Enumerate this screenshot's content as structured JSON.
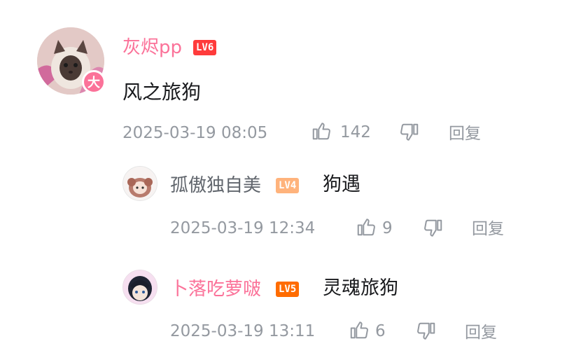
{
  "comment": {
    "username": "灰烬pp",
    "level": "LV6",
    "avatar_badge": "大",
    "text": "风之旅狗",
    "timestamp": "2025-03-19 08:05",
    "likes": "142",
    "reply_label": "回复"
  },
  "replies": [
    {
      "username": "孤傲独自美",
      "level": "LV4",
      "text": "狗遇",
      "timestamp": "2025-03-19 12:34",
      "likes": "9",
      "reply_label": "回复"
    },
    {
      "username": "卜落吃萝啵",
      "level": "LV5",
      "text": "灵魂旅狗",
      "timestamp": "2025-03-19 13:11",
      "likes": "6",
      "reply_label": "回复"
    }
  ],
  "colors": {
    "username_pink": "#fb7299",
    "username_gray": "#61666d",
    "meta_gray": "#9499a0",
    "lv6": "#ff3b3b",
    "lv5": "#ff6c00",
    "lv4": "#ffb37c"
  },
  "icons": [
    "thumbs-up-icon",
    "thumbs-down-icon"
  ]
}
